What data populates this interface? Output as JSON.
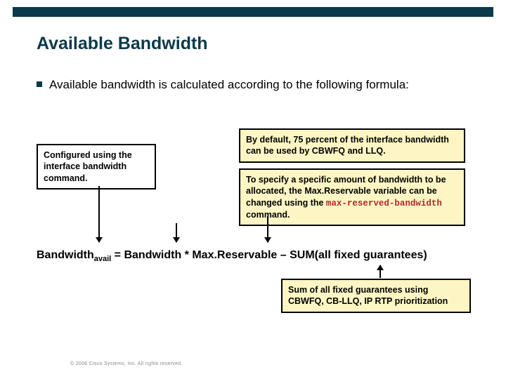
{
  "title": "Available Bandwidth",
  "bullet": "Available bandwidth is calculated according to the following formula:",
  "box_left": {
    "l1": "Configured using the ",
    "l2a": "interface ",
    "l2b": "bandwidth",
    "l3": " command."
  },
  "box_topright": "By default, 75 percent of the interface bandwidth can be used by CBWFQ and LLQ.",
  "box_midright": {
    "pre": "To specify a specific amount of bandwidth to be allocated, the Max.Reservable variable can be changed using the ",
    "cmd": "max-reserved-bandwidth",
    "post": " command."
  },
  "formula": {
    "lhs_base": "Bandwidth",
    "lhs_sub": "avail",
    "rhs": " = Bandwidth * Max.Reservable – SUM(all fixed guarantees)"
  },
  "box_sum": "Sum of all fixed guarantees using CBWFQ, CB-LLQ, IP RTP prioritization",
  "copyright": "© 2006 Cisco Systems, Inc. All rights reserved."
}
